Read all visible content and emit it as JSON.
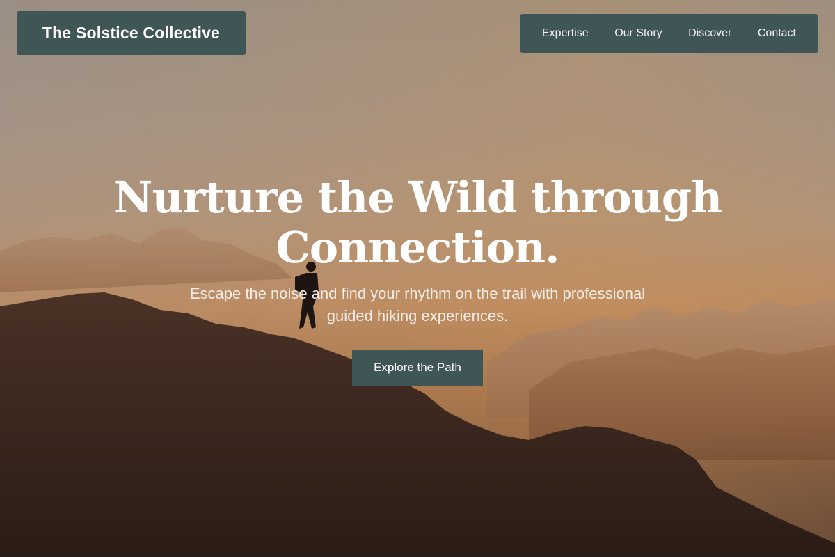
{
  "brand": {
    "name": "The Solstice Collective"
  },
  "nav": {
    "items": [
      {
        "label": "Expertise"
      },
      {
        "label": "Our Story"
      },
      {
        "label": "Discover"
      },
      {
        "label": "Contact"
      }
    ]
  },
  "hero": {
    "headline": "Nurture the Wild through Connection.",
    "subtext": "Escape the noise and find your rhythm on the trail with professional guided hiking experiences.",
    "cta_label": "Explore the Path"
  },
  "colors": {
    "accent": "#3f5556",
    "text_light": "#ffffff"
  }
}
